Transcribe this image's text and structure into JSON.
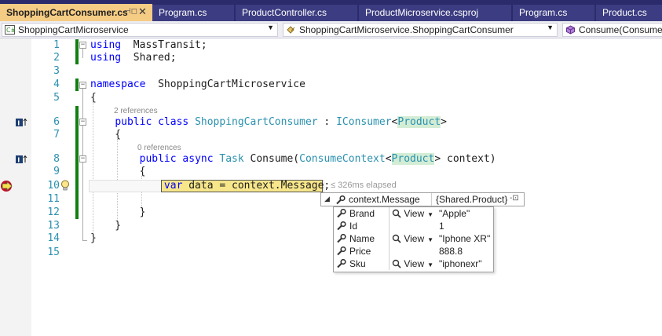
{
  "tabs": [
    {
      "label": "ShoppingCartConsumer.cs",
      "active": true
    },
    {
      "label": "Program.cs",
      "active": false
    },
    {
      "label": "ProductController.cs",
      "active": false
    },
    {
      "label": "ProductMicroservice.csproj",
      "active": false
    },
    {
      "label": "Program.cs",
      "active": false
    },
    {
      "label": "Product.cs",
      "active": false
    }
  ],
  "navbar": {
    "project": "ShoppingCartMicroservice",
    "type": "ShoppingCartMicroservice.ShoppingCartConsumer",
    "member": "Consume(ConsumeContext<Product> context)"
  },
  "editor": {
    "lines": [
      {
        "n": "1",
        "tokens": [
          [
            "kw",
            "using"
          ],
          [
            "",
            "  MassTransit;"
          ]
        ]
      },
      {
        "n": "2",
        "tokens": [
          [
            "kw",
            "using"
          ],
          [
            "",
            "  Shared;"
          ]
        ]
      },
      {
        "n": "3",
        "tokens": []
      },
      {
        "n": "4",
        "tokens": [
          [
            "kw",
            "namespace"
          ],
          [
            "",
            "  ShoppingCartMicroservice"
          ]
        ]
      },
      {
        "n": "5",
        "tokens": [
          [
            "",
            "{"
          ]
        ]
      },
      {
        "n": "6",
        "tokens": [
          [
            "",
            "    "
          ],
          [
            "kw",
            "public class"
          ],
          [
            "",
            " "
          ],
          [
            "ty",
            "ShoppingCartConsumer"
          ],
          [
            "",
            " : "
          ],
          [
            "ty",
            "IConsumer"
          ],
          [
            "",
            "<"
          ],
          [
            "hl",
            "Product"
          ],
          [
            "",
            ">"
          ]
        ]
      },
      {
        "n": "7",
        "tokens": [
          [
            "",
            "    {"
          ]
        ]
      },
      {
        "n": "8",
        "tokens": [
          [
            "",
            "        "
          ],
          [
            "kw",
            "public async"
          ],
          [
            "",
            " "
          ],
          [
            "ty",
            "Task"
          ],
          [
            "",
            " Consume("
          ],
          [
            "ty",
            "ConsumeContext"
          ],
          [
            "",
            "<"
          ],
          [
            "hl",
            "Product"
          ],
          [
            "",
            "> context)"
          ]
        ]
      },
      {
        "n": "9",
        "tokens": [
          [
            "",
            "        {"
          ]
        ]
      },
      {
        "n": "10",
        "tokens": [
          [
            "",
            "            "
          ],
          [
            "kw",
            "var"
          ],
          [
            "",
            " data = context.Message;"
          ]
        ]
      },
      {
        "n": "11",
        "tokens": []
      },
      {
        "n": "12",
        "tokens": [
          [
            "",
            "        }"
          ]
        ]
      },
      {
        "n": "13",
        "tokens": [
          [
            "",
            "    }"
          ]
        ]
      },
      {
        "n": "14",
        "tokens": [
          [
            "",
            "}"
          ]
        ]
      },
      {
        "n": "15",
        "tokens": []
      }
    ],
    "references": [
      "2 references",
      "0 references"
    ],
    "elapsed": "≤ 326ms elapsed"
  },
  "datatip": {
    "expand_glyph": "◢",
    "expression": "context.Message",
    "type": "{Shared.Product}",
    "pin_glyph": "-⊡",
    "view_label": "View",
    "members": [
      {
        "name": "Brand",
        "value": "\"Apple\"",
        "has_view": true
      },
      {
        "name": "Id",
        "value": "1",
        "has_view": false
      },
      {
        "name": "Name",
        "value": "\"Iphone XR\"",
        "has_view": true
      },
      {
        "name": "Price",
        "value": "888.8",
        "has_view": false
      },
      {
        "name": "Sku",
        "value": "\"iphonexr\"",
        "has_view": true
      }
    ]
  },
  "colors": {
    "tab_strip": "#2b2b6b",
    "active_tab": "#f5cc84",
    "keyword": "#0000ff",
    "type": "#2b91af",
    "line_number": "#2b91af",
    "change_bar": "#108010",
    "exec_highlight": "#f7e68a"
  },
  "icons": {
    "tab_pin": "pin-icon",
    "tab_close": "close-icon",
    "project": "csharp-project-icon",
    "class": "class-icon",
    "method": "method-cube-icon",
    "implements": "implements-interface-icon",
    "breakpoint": "breakpoint-current-statement-icon",
    "lightbulb": "lightbulb-icon",
    "property": "wrench-icon",
    "visualizer": "magnifier-icon"
  }
}
